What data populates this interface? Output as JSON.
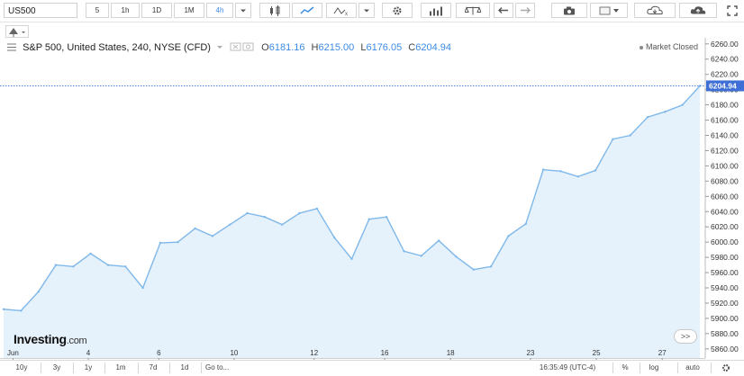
{
  "toolbar": {
    "symbol": "US500",
    "intervals": [
      "5",
      "1h",
      "1D",
      "1M",
      "4h"
    ],
    "active_interval": "4h"
  },
  "legend": {
    "title": "S&P 500, United States, 240, NYSE (CFD)",
    "o_label": "O",
    "o_value": "6181.16",
    "h_label": "H",
    "h_value": "6215.00",
    "l_label": "L",
    "l_value": "6176.05",
    "c_label": "C",
    "c_value": "6204.94",
    "market_status": "Market Closed"
  },
  "logo": {
    "main": "Investing",
    "suffix": ".com"
  },
  "nav_button": ">>",
  "bottom_bar": {
    "ranges": [
      "10y",
      "3y",
      "1y",
      "1m",
      "7d",
      "1d"
    ],
    "goto": "Go to...",
    "clock": "16:35:49 (UTC-4)",
    "percent": "%",
    "log": "log",
    "auto": "auto"
  },
  "colors": {
    "line": "#7fb8ea",
    "fill": "#e5f1fb",
    "accent": "#3d8be6",
    "price_tag": "#3d6fd6"
  },
  "chart_data": {
    "type": "area",
    "title": "S&P 500, United States, 240, NYSE (CFD)",
    "xlabel": "",
    "ylabel": "",
    "x_ticks": [
      "Jun",
      "4",
      "6",
      "10",
      "12",
      "16",
      "18",
      "23",
      "25",
      "27"
    ],
    "y_ticks": [
      5860,
      5880,
      5900,
      5920,
      5940,
      5960,
      5980,
      6000,
      6020,
      6040,
      6060,
      6080,
      6100,
      6120,
      6140,
      6160,
      6180,
      6200,
      6220,
      6240,
      6260
    ],
    "ylim": [
      5848,
      6268
    ],
    "last_value": 6204.94,
    "grid": false,
    "series": [
      {
        "values": [
          5912,
          5910,
          5935,
          5970,
          5968,
          5985,
          5970,
          5968,
          5940,
          5999,
          6000,
          6018,
          6008,
          6023,
          6038,
          6033,
          6023,
          6038,
          6044,
          6006,
          5978,
          6030,
          6033,
          5988,
          5982,
          6002,
          5981,
          5964,
          5968,
          6008,
          6024,
          6095,
          6093,
          6086,
          6094,
          6135,
          6140,
          6164,
          6171,
          6180,
          6204.94
        ]
      }
    ]
  }
}
